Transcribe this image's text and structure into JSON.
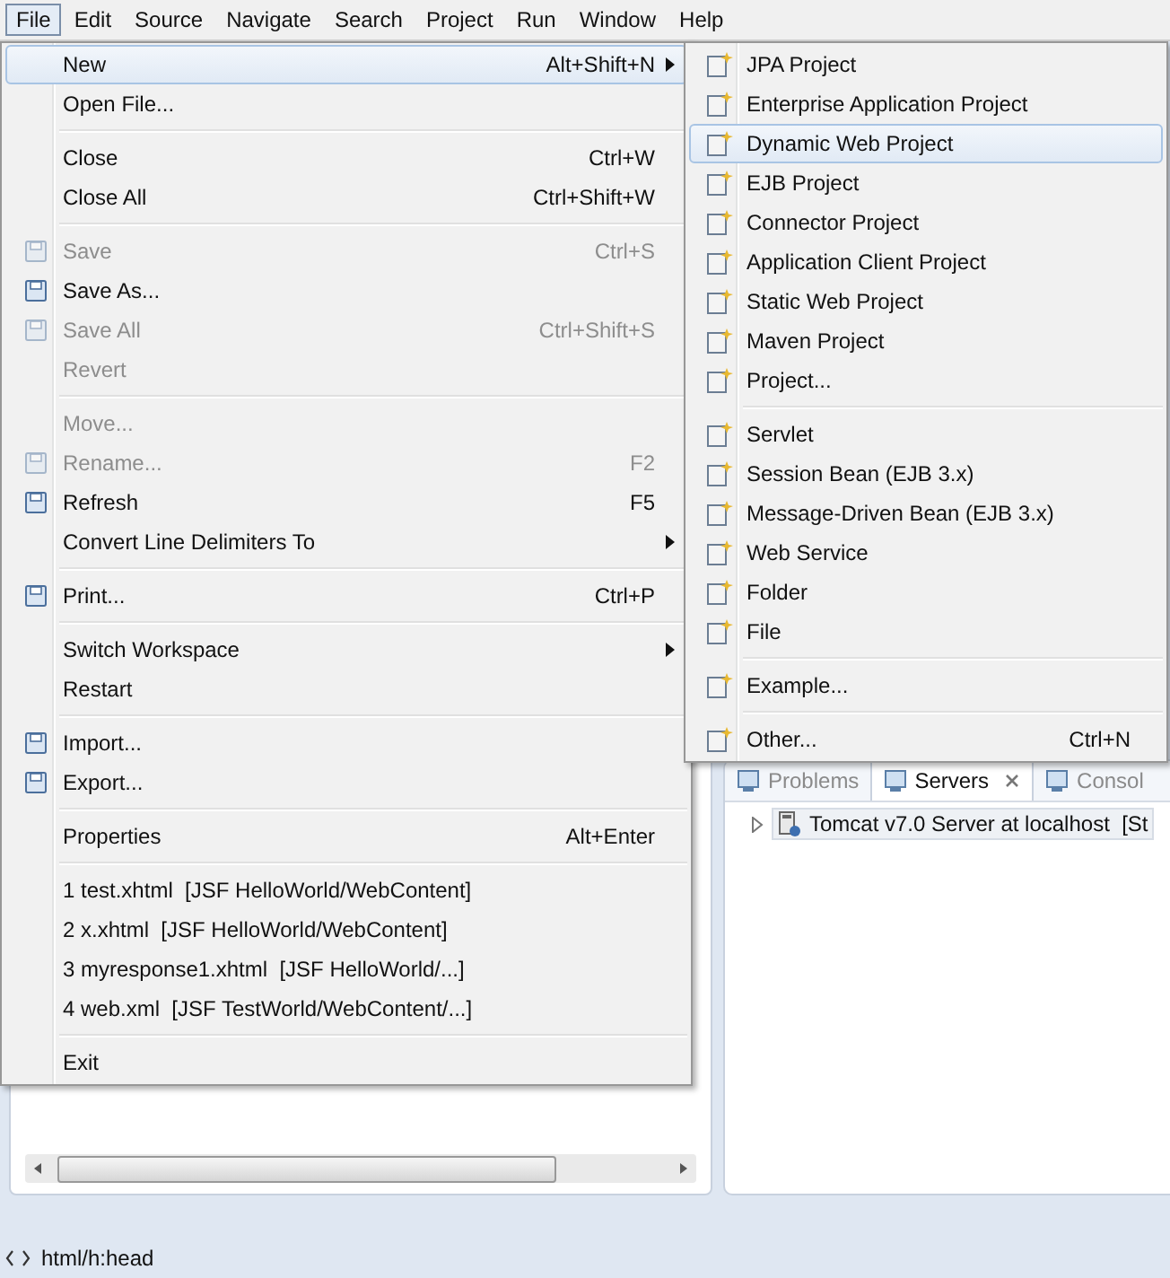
{
  "menubar": [
    {
      "label": "File",
      "selected": true
    },
    {
      "label": "Edit",
      "selected": false
    },
    {
      "label": "Source",
      "selected": false
    },
    {
      "label": "Navigate",
      "selected": false
    },
    {
      "label": "Search",
      "selected": false
    },
    {
      "label": "Project",
      "selected": false
    },
    {
      "label": "Run",
      "selected": false
    },
    {
      "label": "Window",
      "selected": false
    },
    {
      "label": "Help",
      "selected": false
    }
  ],
  "file_menu": {
    "items": [
      {
        "kind": "item",
        "label": "New",
        "shortcut": "Alt+Shift+N",
        "submenu": true,
        "selected": true,
        "disabled": false,
        "icon": false
      },
      {
        "kind": "item",
        "label": "Open File...",
        "selected": false,
        "disabled": false,
        "icon": false
      },
      {
        "kind": "separator"
      },
      {
        "kind": "item",
        "label": "Close",
        "shortcut": "Ctrl+W",
        "selected": false,
        "disabled": false,
        "icon": false
      },
      {
        "kind": "item",
        "label": "Close All",
        "shortcut": "Ctrl+Shift+W",
        "selected": false,
        "disabled": false,
        "icon": false
      },
      {
        "kind": "separator"
      },
      {
        "kind": "item",
        "label": "Save",
        "shortcut": "Ctrl+S",
        "selected": false,
        "disabled": true,
        "icon": true
      },
      {
        "kind": "item",
        "label": "Save As...",
        "selected": false,
        "disabled": false,
        "icon": true
      },
      {
        "kind": "item",
        "label": "Save All",
        "shortcut": "Ctrl+Shift+S",
        "selected": false,
        "disabled": true,
        "icon": true
      },
      {
        "kind": "item",
        "label": "Revert",
        "selected": false,
        "disabled": true,
        "icon": false
      },
      {
        "kind": "separator"
      },
      {
        "kind": "item",
        "label": "Move...",
        "selected": false,
        "disabled": true,
        "icon": false
      },
      {
        "kind": "item",
        "label": "Rename...",
        "shortcut": "F2",
        "selected": false,
        "disabled": true,
        "icon": true
      },
      {
        "kind": "item",
        "label": "Refresh",
        "shortcut": "F5",
        "selected": false,
        "disabled": false,
        "icon": true
      },
      {
        "kind": "item",
        "label": "Convert Line Delimiters To",
        "submenu": true,
        "selected": false,
        "disabled": false,
        "icon": false
      },
      {
        "kind": "separator"
      },
      {
        "kind": "item",
        "label": "Print...",
        "shortcut": "Ctrl+P",
        "selected": false,
        "disabled": false,
        "icon": true
      },
      {
        "kind": "separator"
      },
      {
        "kind": "item",
        "label": "Switch Workspace",
        "submenu": true,
        "selected": false,
        "disabled": false,
        "icon": false
      },
      {
        "kind": "item",
        "label": "Restart",
        "selected": false,
        "disabled": false,
        "icon": false
      },
      {
        "kind": "separator"
      },
      {
        "kind": "item",
        "label": "Import...",
        "selected": false,
        "disabled": false,
        "icon": true
      },
      {
        "kind": "item",
        "label": "Export...",
        "selected": false,
        "disabled": false,
        "icon": true
      },
      {
        "kind": "separator"
      },
      {
        "kind": "item",
        "label": "Properties",
        "shortcut": "Alt+Enter",
        "selected": false,
        "disabled": false,
        "icon": false
      },
      {
        "kind": "separator"
      },
      {
        "kind": "item",
        "label": "1 test.xhtml  [JSF HelloWorld/WebContent]",
        "selected": false,
        "disabled": false,
        "icon": false
      },
      {
        "kind": "item",
        "label": "2 x.xhtml  [JSF HelloWorld/WebContent]",
        "selected": false,
        "disabled": false,
        "icon": false
      },
      {
        "kind": "item",
        "label": "3 myresponse1.xhtml  [JSF HelloWorld/...]",
        "selected": false,
        "disabled": false,
        "icon": false
      },
      {
        "kind": "item",
        "label": "4 web.xml  [JSF TestWorld/WebContent/...]",
        "selected": false,
        "disabled": false,
        "icon": false
      },
      {
        "kind": "separator"
      },
      {
        "kind": "item",
        "label": "Exit",
        "selected": false,
        "disabled": false,
        "icon": false
      }
    ]
  },
  "new_submenu": {
    "items": [
      {
        "kind": "item",
        "label": "JPA Project",
        "selected": false
      },
      {
        "kind": "item",
        "label": "Enterprise Application Project",
        "selected": false
      },
      {
        "kind": "item",
        "label": "Dynamic Web Project",
        "selected": true
      },
      {
        "kind": "item",
        "label": "EJB Project",
        "selected": false
      },
      {
        "kind": "item",
        "label": "Connector Project",
        "selected": false
      },
      {
        "kind": "item",
        "label": "Application Client Project",
        "selected": false
      },
      {
        "kind": "item",
        "label": "Static Web Project",
        "selected": false
      },
      {
        "kind": "item",
        "label": "Maven Project",
        "selected": false
      },
      {
        "kind": "item",
        "label": "Project...",
        "selected": false
      },
      {
        "kind": "separator"
      },
      {
        "kind": "item",
        "label": "Servlet",
        "selected": false
      },
      {
        "kind": "item",
        "label": "Session Bean (EJB 3.x)",
        "selected": false
      },
      {
        "kind": "item",
        "label": "Message-Driven Bean (EJB 3.x)",
        "selected": false
      },
      {
        "kind": "item",
        "label": "Web Service",
        "selected": false
      },
      {
        "kind": "item",
        "label": "Folder",
        "selected": false
      },
      {
        "kind": "item",
        "label": "File",
        "selected": false
      },
      {
        "kind": "separator"
      },
      {
        "kind": "item",
        "label": "Example...",
        "selected": false
      },
      {
        "kind": "separator"
      },
      {
        "kind": "item",
        "label": "Other...",
        "shortcut": "Ctrl+N",
        "selected": false
      }
    ]
  },
  "servers_view": {
    "tabs": [
      {
        "label": "Problems",
        "selected": false,
        "closable": false
      },
      {
        "label": "Servers",
        "selected": true,
        "closable": true
      },
      {
        "label": "Consol",
        "selected": false,
        "closable": false
      }
    ],
    "tree": [
      {
        "label": "Tomcat v7.0 Server at localhost  [St",
        "expanded": false
      }
    ]
  },
  "status_bar": {
    "path": "html/h:head"
  }
}
